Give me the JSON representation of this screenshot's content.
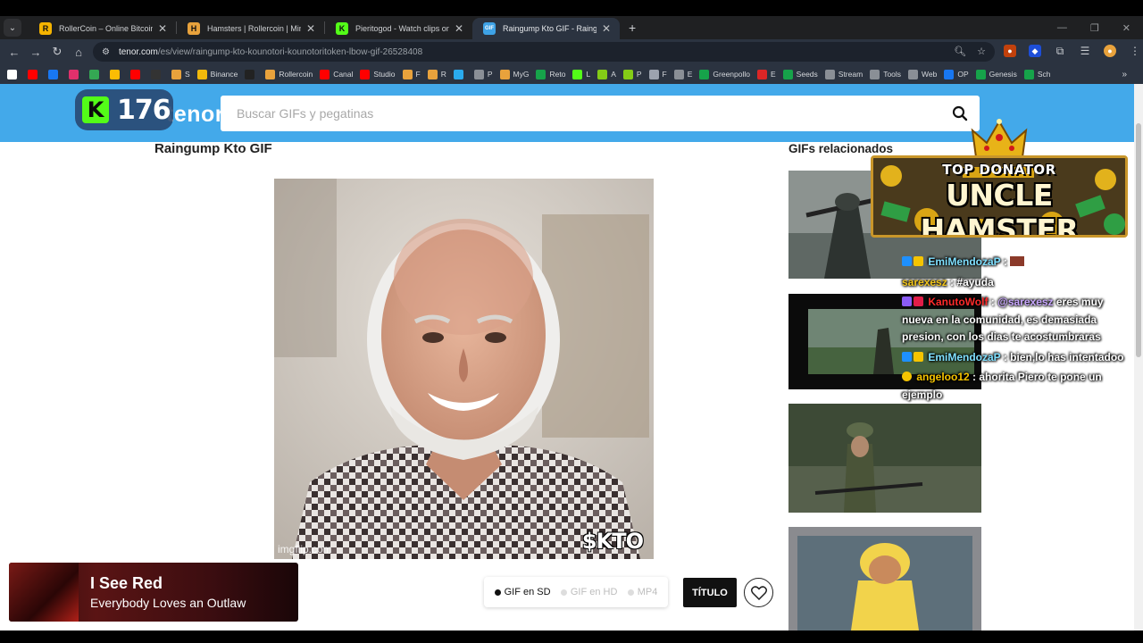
{
  "browser": {
    "tabs": [
      {
        "label": "RollerCoin – Online Bitcoin Mining Simulator",
        "icon": "rollercoin-favicon",
        "color": "#f5b400"
      },
      {
        "label": "Hamsters | Rollercoin | Minar y",
        "icon": "hamster-favicon",
        "color": "#e8a23c"
      },
      {
        "label": "Pieritogod - Watch clips on Kick",
        "icon": "kick-favicon",
        "color": "#53fc18"
      },
      {
        "label": "Raingump Kto GIF - Raingump",
        "icon": "gif-favicon",
        "color": "#3ea2e6"
      }
    ],
    "url_host": "tenor.com",
    "url_path": "/es/view/raingump-kto-kounotori-kounotoritoken-lbow-gif-26528408",
    "bookmarks": [
      {
        "label": "",
        "color": "#ffffff"
      },
      {
        "label": "",
        "color": "#ff0000"
      },
      {
        "label": "",
        "color": "#1877f2"
      },
      {
        "label": "",
        "color": "#e1306c"
      },
      {
        "label": "",
        "color": "#34a853"
      },
      {
        "label": "",
        "color": "#fbbc04"
      },
      {
        "label": "",
        "color": "#ff0000"
      },
      {
        "label": "",
        "color": "#333333"
      },
      {
        "label": "S",
        "color": "#e8a23c"
      },
      {
        "label": "Binance",
        "color": "#f0b90b"
      },
      {
        "label": "",
        "color": "#222222"
      },
      {
        "label": "Rollercoin",
        "color": "#e8a23c"
      },
      {
        "label": "Canal",
        "color": "#ff0000"
      },
      {
        "label": "Studio",
        "color": "#ff0000"
      },
      {
        "label": "F",
        "color": "#e8a23c"
      },
      {
        "label": "R",
        "color": "#e8a23c"
      },
      {
        "label": "",
        "color": "#2aabee"
      },
      {
        "label": "P",
        "color": "#8a8f96"
      },
      {
        "label": "MyG",
        "color": "#e8a23c"
      },
      {
        "label": "Reto",
        "color": "#16a34a"
      },
      {
        "label": "L",
        "color": "#53fc18"
      },
      {
        "label": "A",
        "color": "#84cc16"
      },
      {
        "label": "P",
        "color": "#84cc16"
      },
      {
        "label": "F",
        "color": "#9ca3af"
      },
      {
        "label": "E",
        "color": "#8a8f96"
      },
      {
        "label": "Greenpollo",
        "color": "#16a34a"
      },
      {
        "label": "E",
        "color": "#dc2626"
      },
      {
        "label": "Seeds",
        "color": "#16a34a"
      },
      {
        "label": "Stream",
        "color": "#8a8f96"
      },
      {
        "label": "Tools",
        "color": "#8a8f96"
      },
      {
        "label": "Web",
        "color": "#8a8f96"
      },
      {
        "label": "OP",
        "color": "#1877f2"
      },
      {
        "label": "Genesis",
        "color": "#16a34a"
      },
      {
        "label": "Sch",
        "color": "#16a34a"
      }
    ]
  },
  "tenor": {
    "logo": "tenor",
    "search_placeholder": "Buscar GIFs y pegatinas",
    "gif_title": "Raingump Kto GIF",
    "gif_watermark": "imgflip.com",
    "gif_overlay_text": "$KTO",
    "related_title": "GIFs relacionados",
    "formats": [
      {
        "label": "GIF en SD",
        "active": true
      },
      {
        "label": "GIF en HD",
        "active": false
      },
      {
        "label": "MP4",
        "active": false
      }
    ],
    "titulo_button": "TÍTULO"
  },
  "stream_overlay": {
    "viewer_count": "176",
    "donator_top": "TOP DONATOR",
    "donator_name": "UNCLE HAMSTER",
    "chat": [
      {
        "user": "EmiMendozaP",
        "user_color": "#7fe0ff",
        "sep": " : ",
        "text": "",
        "badges": [
          "#1e90ff",
          "#f5c400"
        ]
      },
      {
        "user": "sarexesz",
        "user_color": "#f0c419",
        "sep": " : ",
        "text": "#ayuda",
        "badges": []
      },
      {
        "user": "KanutoWolf",
        "user_color": "#ff2a2a",
        "sep": " : ",
        "mention": "@sarexesz",
        "text": " eres muy nueva en la comunidad, es demasiada presion, con los dias te acostumbraras",
        "badges": [
          "#8b5cf6",
          "#e11d48"
        ]
      },
      {
        "user": "EmiMendozaP",
        "user_color": "#7fe0ff",
        "sep": " : ",
        "text": "bien,lo has intentadoo",
        "badges": [
          "#1e90ff",
          "#f5c400"
        ]
      },
      {
        "user": "angeloo12",
        "user_color": "#f5c400",
        "sep": " : ",
        "text": "ahorita Piero te pone un ejemplo",
        "badges": [
          "#f5c400"
        ]
      }
    ],
    "now_playing": {
      "title": "I See Red",
      "artist": "Everybody Loves an Outlaw"
    }
  }
}
